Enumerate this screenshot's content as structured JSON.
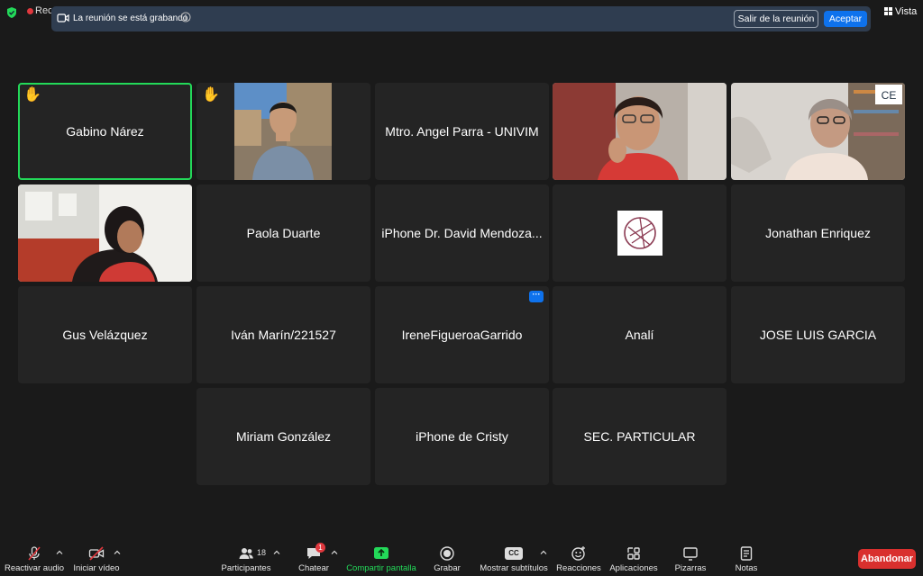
{
  "topbar": {
    "recording_label": "Recc",
    "banner_message": "La reunión se está grabando.",
    "leave_button": "Salir de la reunión",
    "accept_button": "Aceptar",
    "view_button": "Vista"
  },
  "participants": [
    {
      "name": "Gabino Nárez",
      "hand_raised": true,
      "active_speaker": true,
      "video": false
    },
    {
      "name": "",
      "hand_raised": true,
      "video": true
    },
    {
      "name": "Mtro. Angel Parra - UNIVIM",
      "video": false
    },
    {
      "name": "",
      "video": true
    },
    {
      "name": "",
      "video": true
    },
    {
      "name": "",
      "video": true
    },
    {
      "name": "Paola Duarte",
      "video": false
    },
    {
      "name": "iPhone Dr. David Mendoza...",
      "video": false
    },
    {
      "name": "",
      "video": false,
      "avatar": "globe-logo"
    },
    {
      "name": "Jonathan Enriquez",
      "video": false
    },
    {
      "name": "Gus Velázquez",
      "video": false
    },
    {
      "name": "Iván Marín/221527",
      "video": false
    },
    {
      "name": "IreneFigueroaGarrido",
      "video": false,
      "more_badge": "···"
    },
    {
      "name": "Analí",
      "video": false
    },
    {
      "name": "JOSE LUIS GARCIA",
      "video": false
    },
    {
      "name": "Miriam González",
      "video": false
    },
    {
      "name": "iPhone de Cristy",
      "video": false
    },
    {
      "name": "SEC. PARTICULAR",
      "video": false
    }
  ],
  "toolbar": {
    "audio": "Reactivar audio",
    "video": "Iniciar vídeo",
    "participants": "Participantes",
    "participants_count": "18",
    "chat": "Chatear",
    "chat_badge": "1",
    "share": "Compartir pantalla",
    "record": "Grabar",
    "captions": "Mostrar subtítulos",
    "captions_icon_text": "CC",
    "reactions": "Reacciones",
    "apps": "Aplicaciones",
    "whiteboards": "Pizarras",
    "notes": "Notas",
    "end": "Abandonar"
  },
  "colors": {
    "background": "#1a1a1a",
    "tile": "#242424",
    "active_speaker": "#23d959",
    "accent_blue": "#0e72ed",
    "end_red": "#d9302e",
    "banner": "#2f3d50"
  }
}
